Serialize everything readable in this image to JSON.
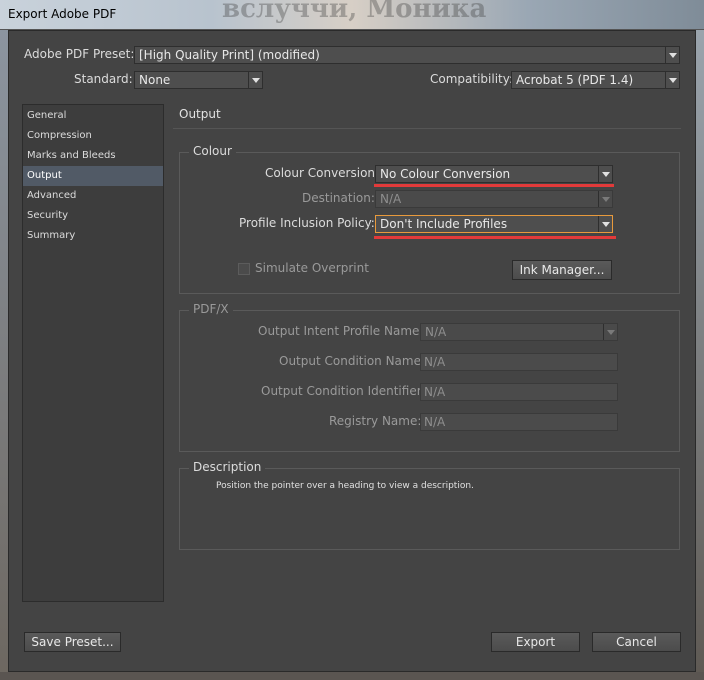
{
  "window": {
    "title": "Export Adobe PDF",
    "background_text": "вслуччи, Моника"
  },
  "top": {
    "preset_label": "Adobe PDF Preset:",
    "preset_value": "[High Quality Print] (modified)",
    "standard_label": "Standard:",
    "standard_value": "None",
    "compat_label": "Compatibility:",
    "compat_value": "Acrobat 5 (PDF 1.4)"
  },
  "sidebar": {
    "items": [
      {
        "label": "General"
      },
      {
        "label": "Compression"
      },
      {
        "label": "Marks and Bleeds"
      },
      {
        "label": "Output"
      },
      {
        "label": "Advanced"
      },
      {
        "label": "Security"
      },
      {
        "label": "Summary"
      }
    ],
    "selected": "Output"
  },
  "main": {
    "header": "Output",
    "colour": {
      "title": "Colour",
      "conversion_label": "Colour Conversion:",
      "conversion_value": "No Colour Conversion",
      "destination_label": "Destination:",
      "destination_value": "N/A",
      "profile_label": "Profile Inclusion Policy:",
      "profile_value": "Don't Include Profiles",
      "simulate_label": "Simulate Overprint",
      "ink_manager_label": "Ink Manager..."
    },
    "pdfx": {
      "title": "PDF/X",
      "intent_label": "Output Intent Profile Name:",
      "intent_value": "N/A",
      "condition_label": "Output Condition Name:",
      "condition_value": "N/A",
      "identifier_label": "Output Condition Identifier:",
      "identifier_value": "N/A",
      "registry_label": "Registry Name:",
      "registry_value": "N/A"
    },
    "description": {
      "title": "Description",
      "text": "Position the pointer over a heading to view a description."
    }
  },
  "footer": {
    "save_preset": "Save Preset...",
    "export": "Export",
    "cancel": "Cancel"
  },
  "colors": {
    "highlight_underline": "#e23a3a",
    "focus_border": "#e89a3c",
    "selection": "#515a66"
  }
}
